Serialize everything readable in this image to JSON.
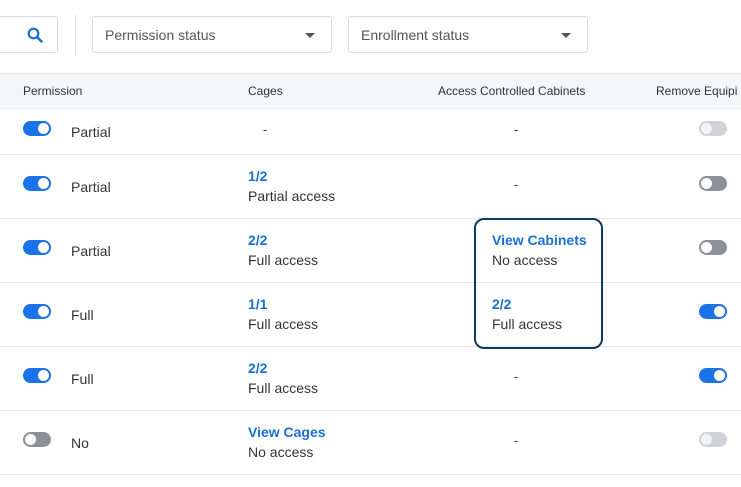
{
  "filters": {
    "permission_status": "Permission status",
    "enrollment_status": "Enrollment status"
  },
  "columns": {
    "permission": "Permission",
    "cages": "Cages",
    "cabinets": "Access Controlled Cabinets",
    "remove_equipment": "Remove Equipi"
  },
  "rows": [
    {
      "permission_on": true,
      "permission": "Partial",
      "cages_link": "",
      "cages_text": "-",
      "cabinets_link": "",
      "cabinets_text": "-",
      "equipment": "disabled"
    },
    {
      "permission_on": true,
      "permission": "Partial",
      "cages_link": "1/2",
      "cages_text": "Partial access",
      "cabinets_link": "",
      "cabinets_text": "-",
      "equipment": "off"
    },
    {
      "permission_on": true,
      "permission": "Partial",
      "cages_link": "2/2",
      "cages_text": "Full access",
      "cabinets_link": "View Cabinets",
      "cabinets_text": "No access",
      "equipment": "off"
    },
    {
      "permission_on": true,
      "permission": "Full",
      "cages_link": "1/1",
      "cages_text": "Full access",
      "cabinets_link": "2/2",
      "cabinets_text": "Full access",
      "equipment": "on"
    },
    {
      "permission_on": true,
      "permission": "Full",
      "cages_link": "2/2",
      "cages_text": "Full access",
      "cabinets_link": "",
      "cabinets_text": "-",
      "equipment": "on"
    },
    {
      "permission_on": false,
      "permission": "No",
      "cages_link": "View Cages",
      "cages_text": "No access",
      "cabinets_link": "",
      "cabinets_text": "-",
      "equipment": "disabled"
    }
  ]
}
